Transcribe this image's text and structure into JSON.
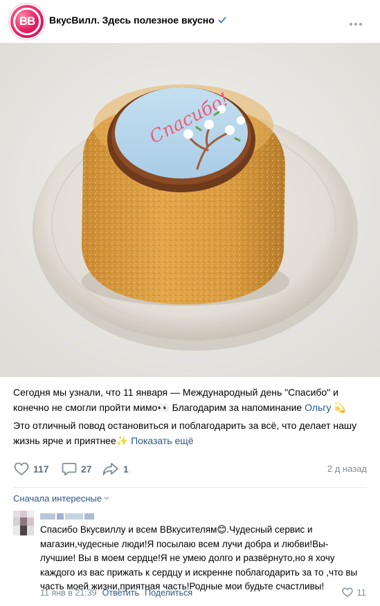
{
  "header": {
    "community_name": "ВкусВилл. Здесь полезное вкусно",
    "avatar_text": "ВВ"
  },
  "image": {
    "cookie_text": "Спасибо!"
  },
  "post": {
    "paragraph1": "Сегодня мы узнали, что 11 января — Международный день \"Спасибо\" и конечно не смогли пройти мимо👀 Благодарим за напоминание ",
    "mention": "Ольгу",
    "mention_emoji": "💫",
    "paragraph2": "Это отличный повод остановиться и поблагодарить за всё, что делает нашу жизнь ярче и приятнее",
    "paragraph2_emoji": "✨",
    "show_more": "Показать ещё"
  },
  "actions": {
    "likes": "117",
    "comments": "27",
    "shares": "1",
    "time": "2 д назад"
  },
  "comments_sort": "Сначала интересные",
  "comment": {
    "text": "Спасибо Вкусвиллу и всем ВВкусителям😊.Чудесный сервис и магазин,чудесные люди!Я посылаю всем лучи добра и любви!Вы- лучшие! Вы в моем сердце!Я не умею долго и развёрнуто,но я хочу каждого из вас прижать к сердцу и искренне поблагодарить за то ,что вы часть моей жизни,приятная часть!Родные мои будьте счастливы!",
    "date": "11 янв в 21:39",
    "reply": "Ответить",
    "share": "Поделиться",
    "likes": "11"
  },
  "colors": {
    "link": "#2a5885",
    "icon": "#818c99",
    "brand": "#e91e63"
  }
}
